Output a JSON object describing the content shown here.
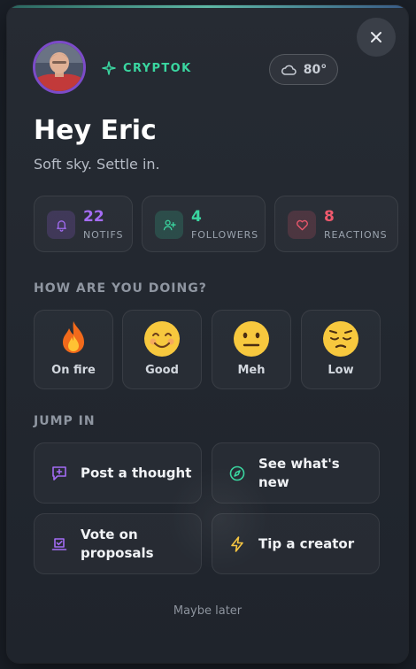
{
  "header": {
    "brand_name": "CRYPTOK",
    "weather": {
      "icon": "cloud-icon",
      "temperature": "80°"
    }
  },
  "greeting": {
    "title": "Hey Eric",
    "subtitle": "Soft sky. Settle in."
  },
  "stats": [
    {
      "icon": "bell-icon",
      "count": "22",
      "label": "NOTIFS",
      "color": "#a46cf5"
    },
    {
      "icon": "user-plus-icon",
      "count": "4",
      "label": "FOLLOWERS",
      "color": "#3ad6a0"
    },
    {
      "icon": "heart-icon",
      "count": "8",
      "label": "REACTIONS",
      "color": "#f0596d"
    }
  ],
  "mood": {
    "title": "HOW ARE YOU DOING?",
    "options": [
      {
        "icon": "fire-emoji",
        "label": "On fire"
      },
      {
        "icon": "smiling-face-emoji",
        "label": "Good"
      },
      {
        "icon": "neutral-face-emoji",
        "label": "Meh"
      },
      {
        "icon": "pensive-face-emoji",
        "label": "Low"
      }
    ]
  },
  "jump_in": {
    "title": "JUMP IN",
    "actions": [
      {
        "icon": "message-plus-icon",
        "label": "Post a thought",
        "color": "#a46cf5"
      },
      {
        "icon": "compass-icon",
        "label": "See what's new",
        "color": "#3ad6a0"
      },
      {
        "icon": "vote-icon",
        "label": "Vote on proposals",
        "color": "#a46cf5"
      },
      {
        "icon": "lightning-icon",
        "label": "Tip a creator",
        "color": "#f5c542"
      }
    ]
  },
  "footer": {
    "dismiss_label": "Maybe later"
  }
}
